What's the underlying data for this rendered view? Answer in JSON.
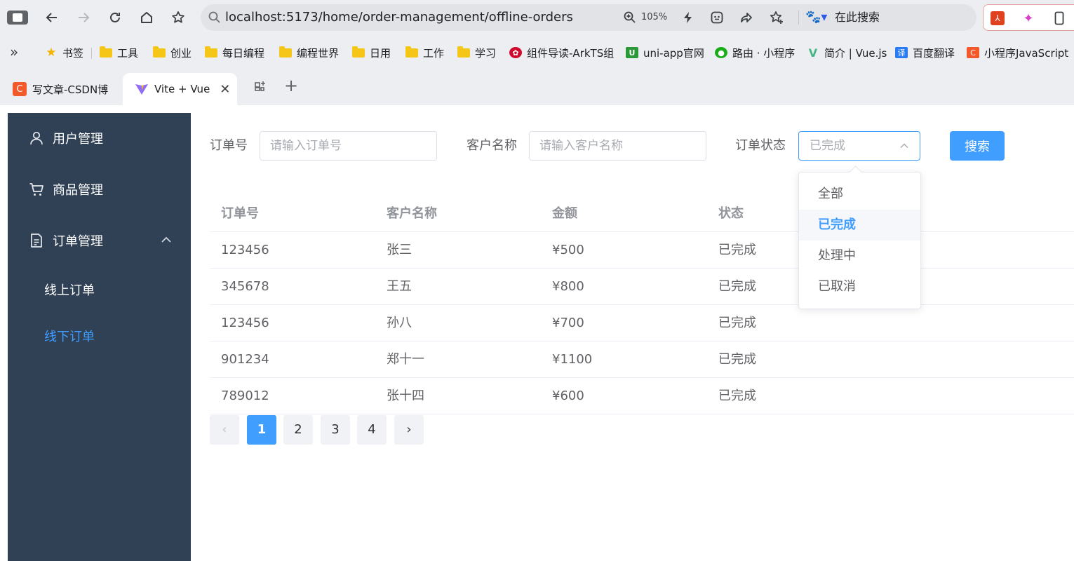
{
  "browser": {
    "url": "localhost:5173/home/order-management/offline-orders",
    "zoom": "105%",
    "search_engine_label": "在此搜索",
    "bookmarks": [
      {
        "label": "书签",
        "icon": "star-icon"
      },
      {
        "label": "工具",
        "icon": "folder-icon"
      },
      {
        "label": "创业",
        "icon": "folder-icon"
      },
      {
        "label": "每日编程",
        "icon": "folder-icon"
      },
      {
        "label": "编程世界",
        "icon": "folder-icon"
      },
      {
        "label": "日用",
        "icon": "folder-icon"
      },
      {
        "label": "工作",
        "icon": "folder-icon"
      },
      {
        "label": "学习",
        "icon": "folder-icon"
      },
      {
        "label": "组件导读-ArkTS组",
        "icon": "huawei-icon"
      },
      {
        "label": "uni-app官网",
        "icon": "uniapp-icon"
      },
      {
        "label": "路由 · 小程序",
        "icon": "wechat-icon"
      },
      {
        "label": "简介 | Vue.js",
        "icon": "vue-icon"
      },
      {
        "label": "百度翻译",
        "icon": "translate-icon"
      },
      {
        "label": "小程序JavaScript",
        "icon": "csdn-icon"
      }
    ],
    "tabs": [
      {
        "label": "写文章-CSDN博",
        "active": false
      },
      {
        "label": "Vite + Vue",
        "active": true
      }
    ]
  },
  "sidebar": {
    "items": [
      {
        "label": "用户管理",
        "icon": "user-icon"
      },
      {
        "label": "商品管理",
        "icon": "cart-icon"
      },
      {
        "label": "订单管理",
        "icon": "document-icon",
        "expanded": true,
        "children": [
          {
            "label": "线上订单",
            "active": false
          },
          {
            "label": "线下订单",
            "active": true
          }
        ]
      }
    ]
  },
  "filters": {
    "order_no_label": "订单号",
    "order_no_placeholder": "请输入订单号",
    "customer_label": "客户名称",
    "customer_placeholder": "请输入客户名称",
    "status_label": "订单状态",
    "status_value": "已完成",
    "search_button": "搜索"
  },
  "status_dropdown": {
    "options": [
      "全部",
      "已完成",
      "处理中",
      "已取消"
    ],
    "selected_index": 1
  },
  "table": {
    "headers": [
      "订单号",
      "客户名称",
      "金额",
      "状态"
    ],
    "rows": [
      [
        "123456",
        "张三",
        "¥500",
        "已完成"
      ],
      [
        "345678",
        "王五",
        "¥800",
        "已完成"
      ],
      [
        "123456",
        "孙八",
        "¥700",
        "已完成"
      ],
      [
        "901234",
        "郑十一",
        "¥1100",
        "已完成"
      ],
      [
        "789012",
        "张十四",
        "¥600",
        "已完成"
      ]
    ]
  },
  "pagination": {
    "pages": [
      "1",
      "2",
      "3",
      "4"
    ],
    "current": "1",
    "prev": "‹",
    "next": "›"
  },
  "colors": {
    "sidebar_bg": "#304156",
    "accent": "#409eff"
  }
}
